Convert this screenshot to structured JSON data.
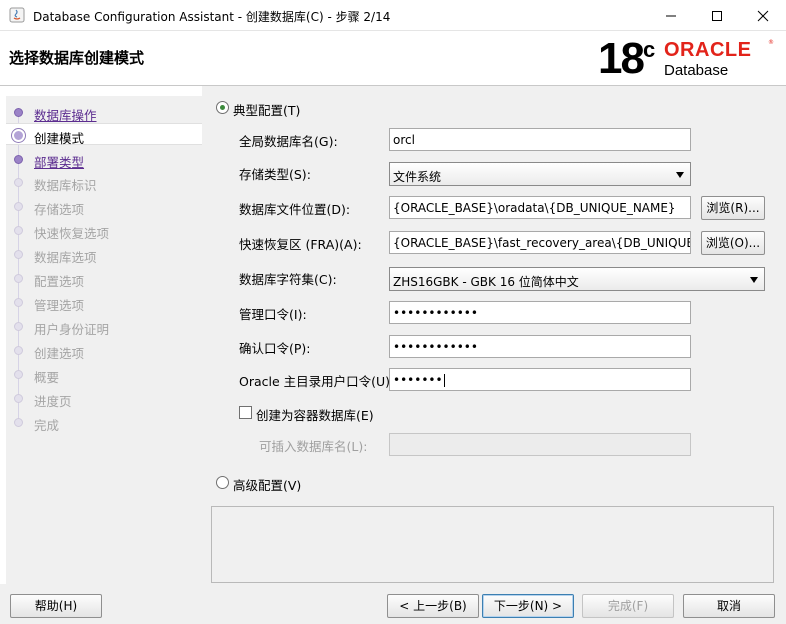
{
  "window": {
    "title": "Database Configuration Assistant - 创建数据库(C) - 步骤 2/14"
  },
  "header": {
    "page_title": "选择数据库创建模式",
    "logo": {
      "version": "18",
      "suffix": "c",
      "brand": "ORACLE",
      "product": "Database"
    }
  },
  "steps": [
    {
      "label": "数据库操作",
      "state": "done"
    },
    {
      "label": "创建模式",
      "state": "current"
    },
    {
      "label": "部署类型",
      "state": "done"
    },
    {
      "label": "数据库标识",
      "state": "future"
    },
    {
      "label": "存储选项",
      "state": "future"
    },
    {
      "label": "快速恢复选项",
      "state": "future"
    },
    {
      "label": "数据库选项",
      "state": "future"
    },
    {
      "label": "配置选项",
      "state": "future"
    },
    {
      "label": "管理选项",
      "state": "future"
    },
    {
      "label": "用户身份证明",
      "state": "future"
    },
    {
      "label": "创建选项",
      "state": "future"
    },
    {
      "label": "概要",
      "state": "future"
    },
    {
      "label": "进度页",
      "state": "future"
    },
    {
      "label": "完成",
      "state": "future"
    }
  ],
  "form": {
    "typical_label": "典型配置(T)",
    "typical_selected": true,
    "global_db_name_label": "全局数据库名(G):",
    "global_db_name_value": "orcl",
    "storage_type_label": "存储类型(S):",
    "storage_type_value": "文件系统",
    "db_file_location_label": "数据库文件位置(D):",
    "db_file_location_value": "{ORACLE_BASE}\\oradata\\{DB_UNIQUE_NAME}",
    "browse_r_label": "浏览(R)...",
    "fra_label": "快速恢复区 (FRA)(A):",
    "fra_value": "{ORACLE_BASE}\\fast_recovery_area\\{DB_UNIQUE_NAME}",
    "browse_o_label": "浏览(O)...",
    "charset_label": "数据库字符集(C):",
    "charset_value": "ZHS16GBK - GBK 16 位简体中文",
    "admin_pwd_label": "管理口令(I):",
    "admin_pwd_value": "••••••••••••",
    "confirm_pwd_label": "确认口令(P):",
    "confirm_pwd_value": "••••••••••••",
    "oracle_home_pwd_label": "Oracle 主目录用户口令(U):",
    "oracle_home_pwd_value": "•••••••",
    "container_db_label": "创建为容器数据库(E)",
    "container_db_checked": false,
    "pdb_name_label": "可插入数据库名(L):",
    "pdb_name_value": "",
    "advanced_label": "高级配置(V)",
    "advanced_selected": false
  },
  "footer": {
    "help_label": "帮助(H)",
    "back_label": "< 上一步(B)",
    "next_label": "下一步(N) >",
    "finish_label": "完成(F)",
    "cancel_label": "取消"
  }
}
